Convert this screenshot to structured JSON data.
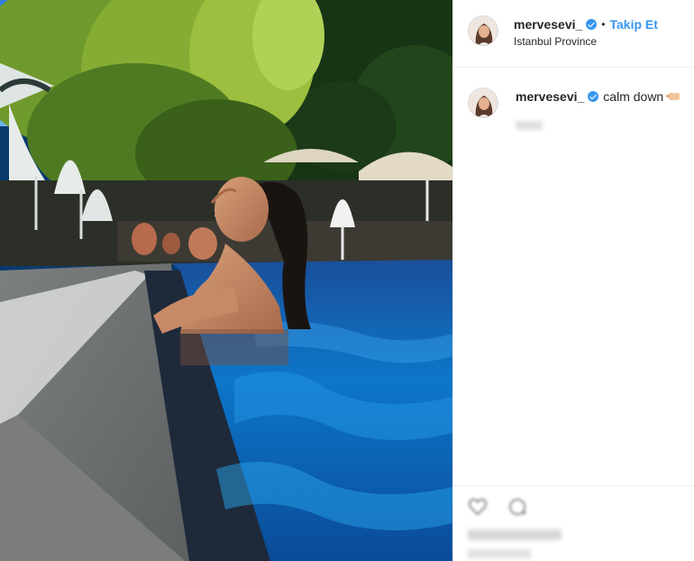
{
  "post": {
    "username": "mervesevi_",
    "separator": "•",
    "follow_label": "Takip Et",
    "location": "Istanbul Province",
    "caption": "calm down",
    "icons": {
      "verified": "verified-badge-icon",
      "emoji": "hand-emoji-icon",
      "like": "heart-icon",
      "comment": "comment-icon"
    },
    "colors": {
      "accent": "#3897f0",
      "text": "#262626",
      "divider": "#efefef"
    }
  }
}
